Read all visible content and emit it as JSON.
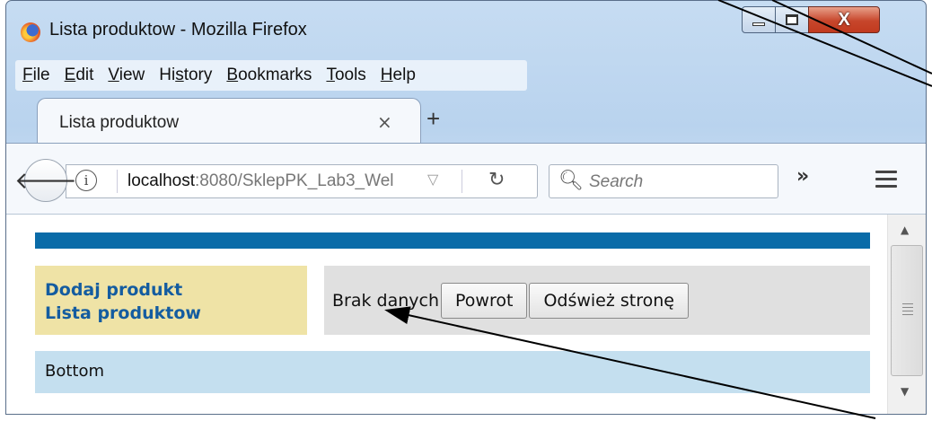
{
  "window": {
    "title": "Lista produktow - Mozilla Firefox",
    "minimize_label": "",
    "maximize_label": "",
    "close_label": "X"
  },
  "menubar": {
    "items": [
      {
        "accel": "F",
        "rest": "ile"
      },
      {
        "accel": "E",
        "rest": "dit"
      },
      {
        "accel": "V",
        "rest": "iew"
      },
      {
        "pre": "Hi",
        "accel": "s",
        "rest": "tory"
      },
      {
        "accel": "B",
        "rest": "ookmarks"
      },
      {
        "accel": "T",
        "rest": "ools"
      },
      {
        "accel": "H",
        "rest": "elp"
      }
    ]
  },
  "tabs": {
    "active_title": "Lista produktow",
    "close_glyph": "×",
    "new_tab_glyph": "+"
  },
  "navbar": {
    "url_host": "localhost",
    "url_rest": ":8080/SklepPK_Lab3_Wel",
    "search_placeholder": "Search"
  },
  "page": {
    "menu_links": [
      "Dodaj produkt",
      "Lista produktow"
    ],
    "no_data_text": "Brak danych",
    "back_button": "Powrot",
    "refresh_button": "Odśwież stronę",
    "footer_text": "Bottom"
  },
  "colors": {
    "topbar": "#0a6ba8",
    "leftmenu_bg": "#efe3a6",
    "link": "#145ca0",
    "mainpanel_bg": "#e0e0e0",
    "footer_bg": "#c4dfef"
  }
}
